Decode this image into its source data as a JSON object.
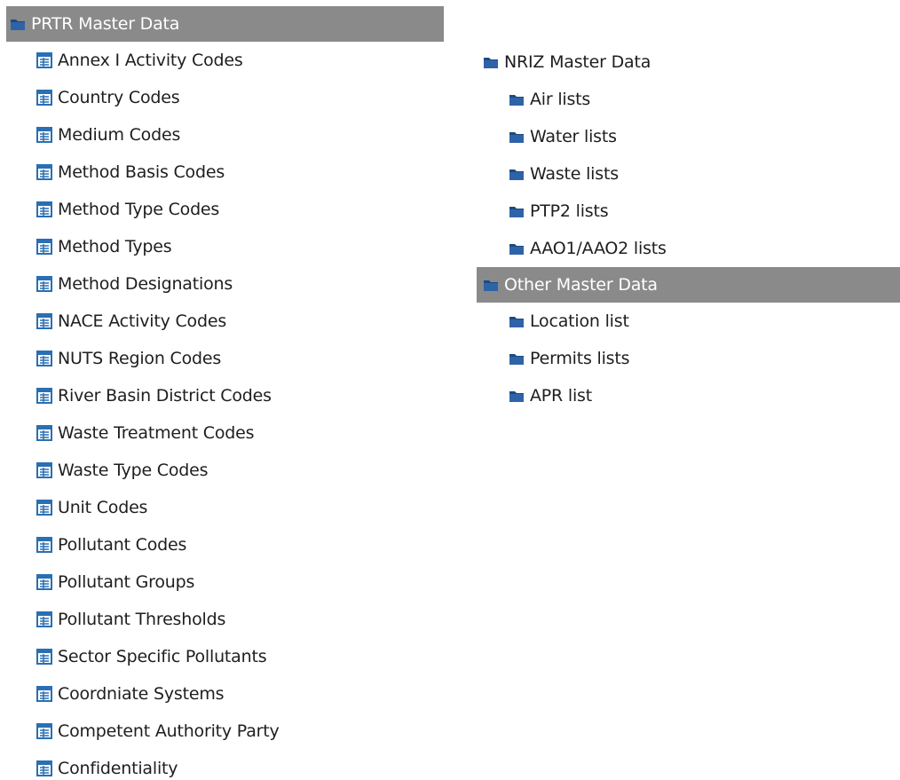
{
  "left_tree": {
    "header": {
      "label": "PRTR Master Data",
      "icon": "folder-icon",
      "selected": true
    },
    "items": [
      {
        "label": "Annex I Activity Codes",
        "icon": "table-icon"
      },
      {
        "label": "Country Codes",
        "icon": "table-icon"
      },
      {
        "label": "Medium Codes",
        "icon": "table-icon"
      },
      {
        "label": "Method Basis Codes",
        "icon": "table-icon"
      },
      {
        "label": "Method Type Codes",
        "icon": "table-icon"
      },
      {
        "label": "Method Types",
        "icon": "table-icon"
      },
      {
        "label": "Method Designations",
        "icon": "table-icon"
      },
      {
        "label": "NACE Activity Codes",
        "icon": "table-icon"
      },
      {
        "label": "NUTS Region Codes",
        "icon": "table-icon"
      },
      {
        "label": "River Basin District Codes",
        "icon": "table-icon"
      },
      {
        "label": "Waste Treatment Codes",
        "icon": "table-icon"
      },
      {
        "label": "Waste Type Codes",
        "icon": "table-icon"
      },
      {
        "label": "Unit Codes",
        "icon": "table-icon"
      },
      {
        "label": "Pollutant Codes",
        "icon": "table-icon"
      },
      {
        "label": "Pollutant Groups",
        "icon": "table-icon"
      },
      {
        "label": "Pollutant Thresholds",
        "icon": "table-icon"
      },
      {
        "label": "Sector Specific Pollutants",
        "icon": "table-icon"
      },
      {
        "label": "Coordniate Systems",
        "icon": "table-icon"
      },
      {
        "label": "Competent Authority Party",
        "icon": "table-icon"
      },
      {
        "label": "Confidentiality",
        "icon": "table-icon"
      }
    ]
  },
  "right_tree": {
    "nriz": {
      "label": "NRIZ Master Data",
      "icon": "folder-icon",
      "items": [
        {
          "label": "Air lists",
          "icon": "folder-icon"
        },
        {
          "label": "Water lists",
          "icon": "folder-icon"
        },
        {
          "label": "Waste lists",
          "icon": "folder-icon"
        },
        {
          "label": "PTP2 lists",
          "icon": "folder-icon"
        },
        {
          "label": "AAO1/AAO2 lists",
          "icon": "folder-icon"
        }
      ]
    },
    "other": {
      "label": "Other Master Data",
      "icon": "folder-icon",
      "selected": true,
      "items": [
        {
          "label": "Location list",
          "icon": "folder-icon"
        },
        {
          "label": "Permits lists",
          "icon": "folder-icon"
        },
        {
          "label": "APR list",
          "icon": "folder-icon"
        }
      ]
    }
  },
  "colors": {
    "folder_blue": "#1c4a82",
    "folder_blue_light": "#2f63a8",
    "table_icon_blue": "#2a6fb3",
    "selected_bg": "#8a8a8a",
    "text": "#1e1e1e"
  }
}
